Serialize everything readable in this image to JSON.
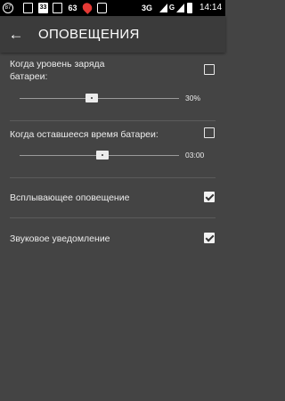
{
  "status_bar": {
    "notification_1": "87",
    "notification_2": "33",
    "notification_3": "63",
    "network": "3G",
    "network_sub": "G",
    "time": "14:14"
  },
  "app_bar": {
    "title": "ОПОВЕЩЕНИЯ"
  },
  "settings": {
    "battery_level": {
      "label_line1": "Когда уровень заряда",
      "label_line2": "батареи:",
      "checked": false,
      "slider_fraction": 0.45,
      "value": "30%"
    },
    "battery_time": {
      "label": "Когда оставшееся время батареи:",
      "checked": false,
      "slider_fraction": 0.52,
      "value": "03:00"
    },
    "popup_alert": {
      "label": "Всплывающее оповещение",
      "checked": true
    },
    "sound_alert": {
      "label": "Звуковое уведомление",
      "checked": true
    }
  }
}
